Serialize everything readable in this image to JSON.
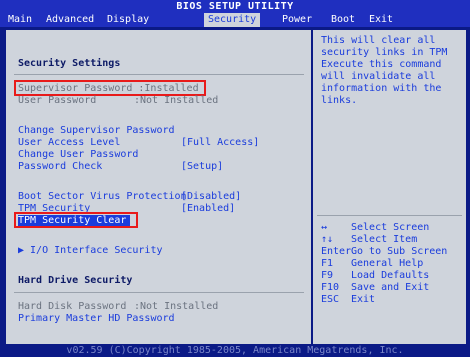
{
  "title": "BIOS SETUP UTILITY",
  "menu": {
    "tabs": [
      {
        "label": "Main"
      },
      {
        "label": "Advanced"
      },
      {
        "label": "Display"
      },
      {
        "label": "Security"
      },
      {
        "label": "Power"
      },
      {
        "label": "Boot"
      },
      {
        "label": "Exit"
      }
    ],
    "active": "Security"
  },
  "main": {
    "heading": "Security Settings",
    "supervisor_password": {
      "label": "Supervisor Password",
      "value": ":Installed"
    },
    "user_password": {
      "label": "User Password",
      "value": ":Not Installed"
    },
    "change_supervisor": "Change Supervisor Password",
    "user_access_level": {
      "label": "User Access Level",
      "value": "[Full Access]"
    },
    "change_user": "Change User Password",
    "password_check": {
      "label": "Password Check",
      "value": "[Setup]"
    },
    "boot_sector": {
      "label": "Boot Sector Virus Protection",
      "value": "[Disabled]"
    },
    "tpm_security": {
      "label": "TPM Security",
      "value": "[Enabled]"
    },
    "tpm_clear": "TPM Security Clear",
    "io_interface": "▶ I/O Interface Security",
    "hard_drive_heading": "Hard Drive Security",
    "hdd_password": {
      "label": "Hard Disk Password",
      "value": ":Not Installed"
    },
    "primary_master": "Primary Master HD Password"
  },
  "help": {
    "lines": [
      "This will clear all",
      "security links in TPM",
      "Execute this command",
      "will invalidate all",
      "information with the",
      "links."
    ],
    "keys": [
      {
        "key": "↔",
        "action": "Select Screen"
      },
      {
        "key": "↑↓",
        "action": "Select Item"
      },
      {
        "key": "Enter",
        "action": "Go to Sub Screen"
      },
      {
        "key": "F1",
        "action": "General Help"
      },
      {
        "key": "F9",
        "action": "Load Defaults"
      },
      {
        "key": "F10",
        "action": "Save and Exit"
      },
      {
        "key": "ESC",
        "action": "Exit"
      }
    ]
  },
  "footer": "v02.59 (C)Copyright 1985-2005, American Megatrends, Inc.",
  "colors": {
    "background": "#0b1a86",
    "bar": "#1f2fbf",
    "panel": "#cfd4dc",
    "text_blue": "#1a3cdc",
    "heading": "#0d1a66",
    "highlight_border": "#e81a1a"
  }
}
